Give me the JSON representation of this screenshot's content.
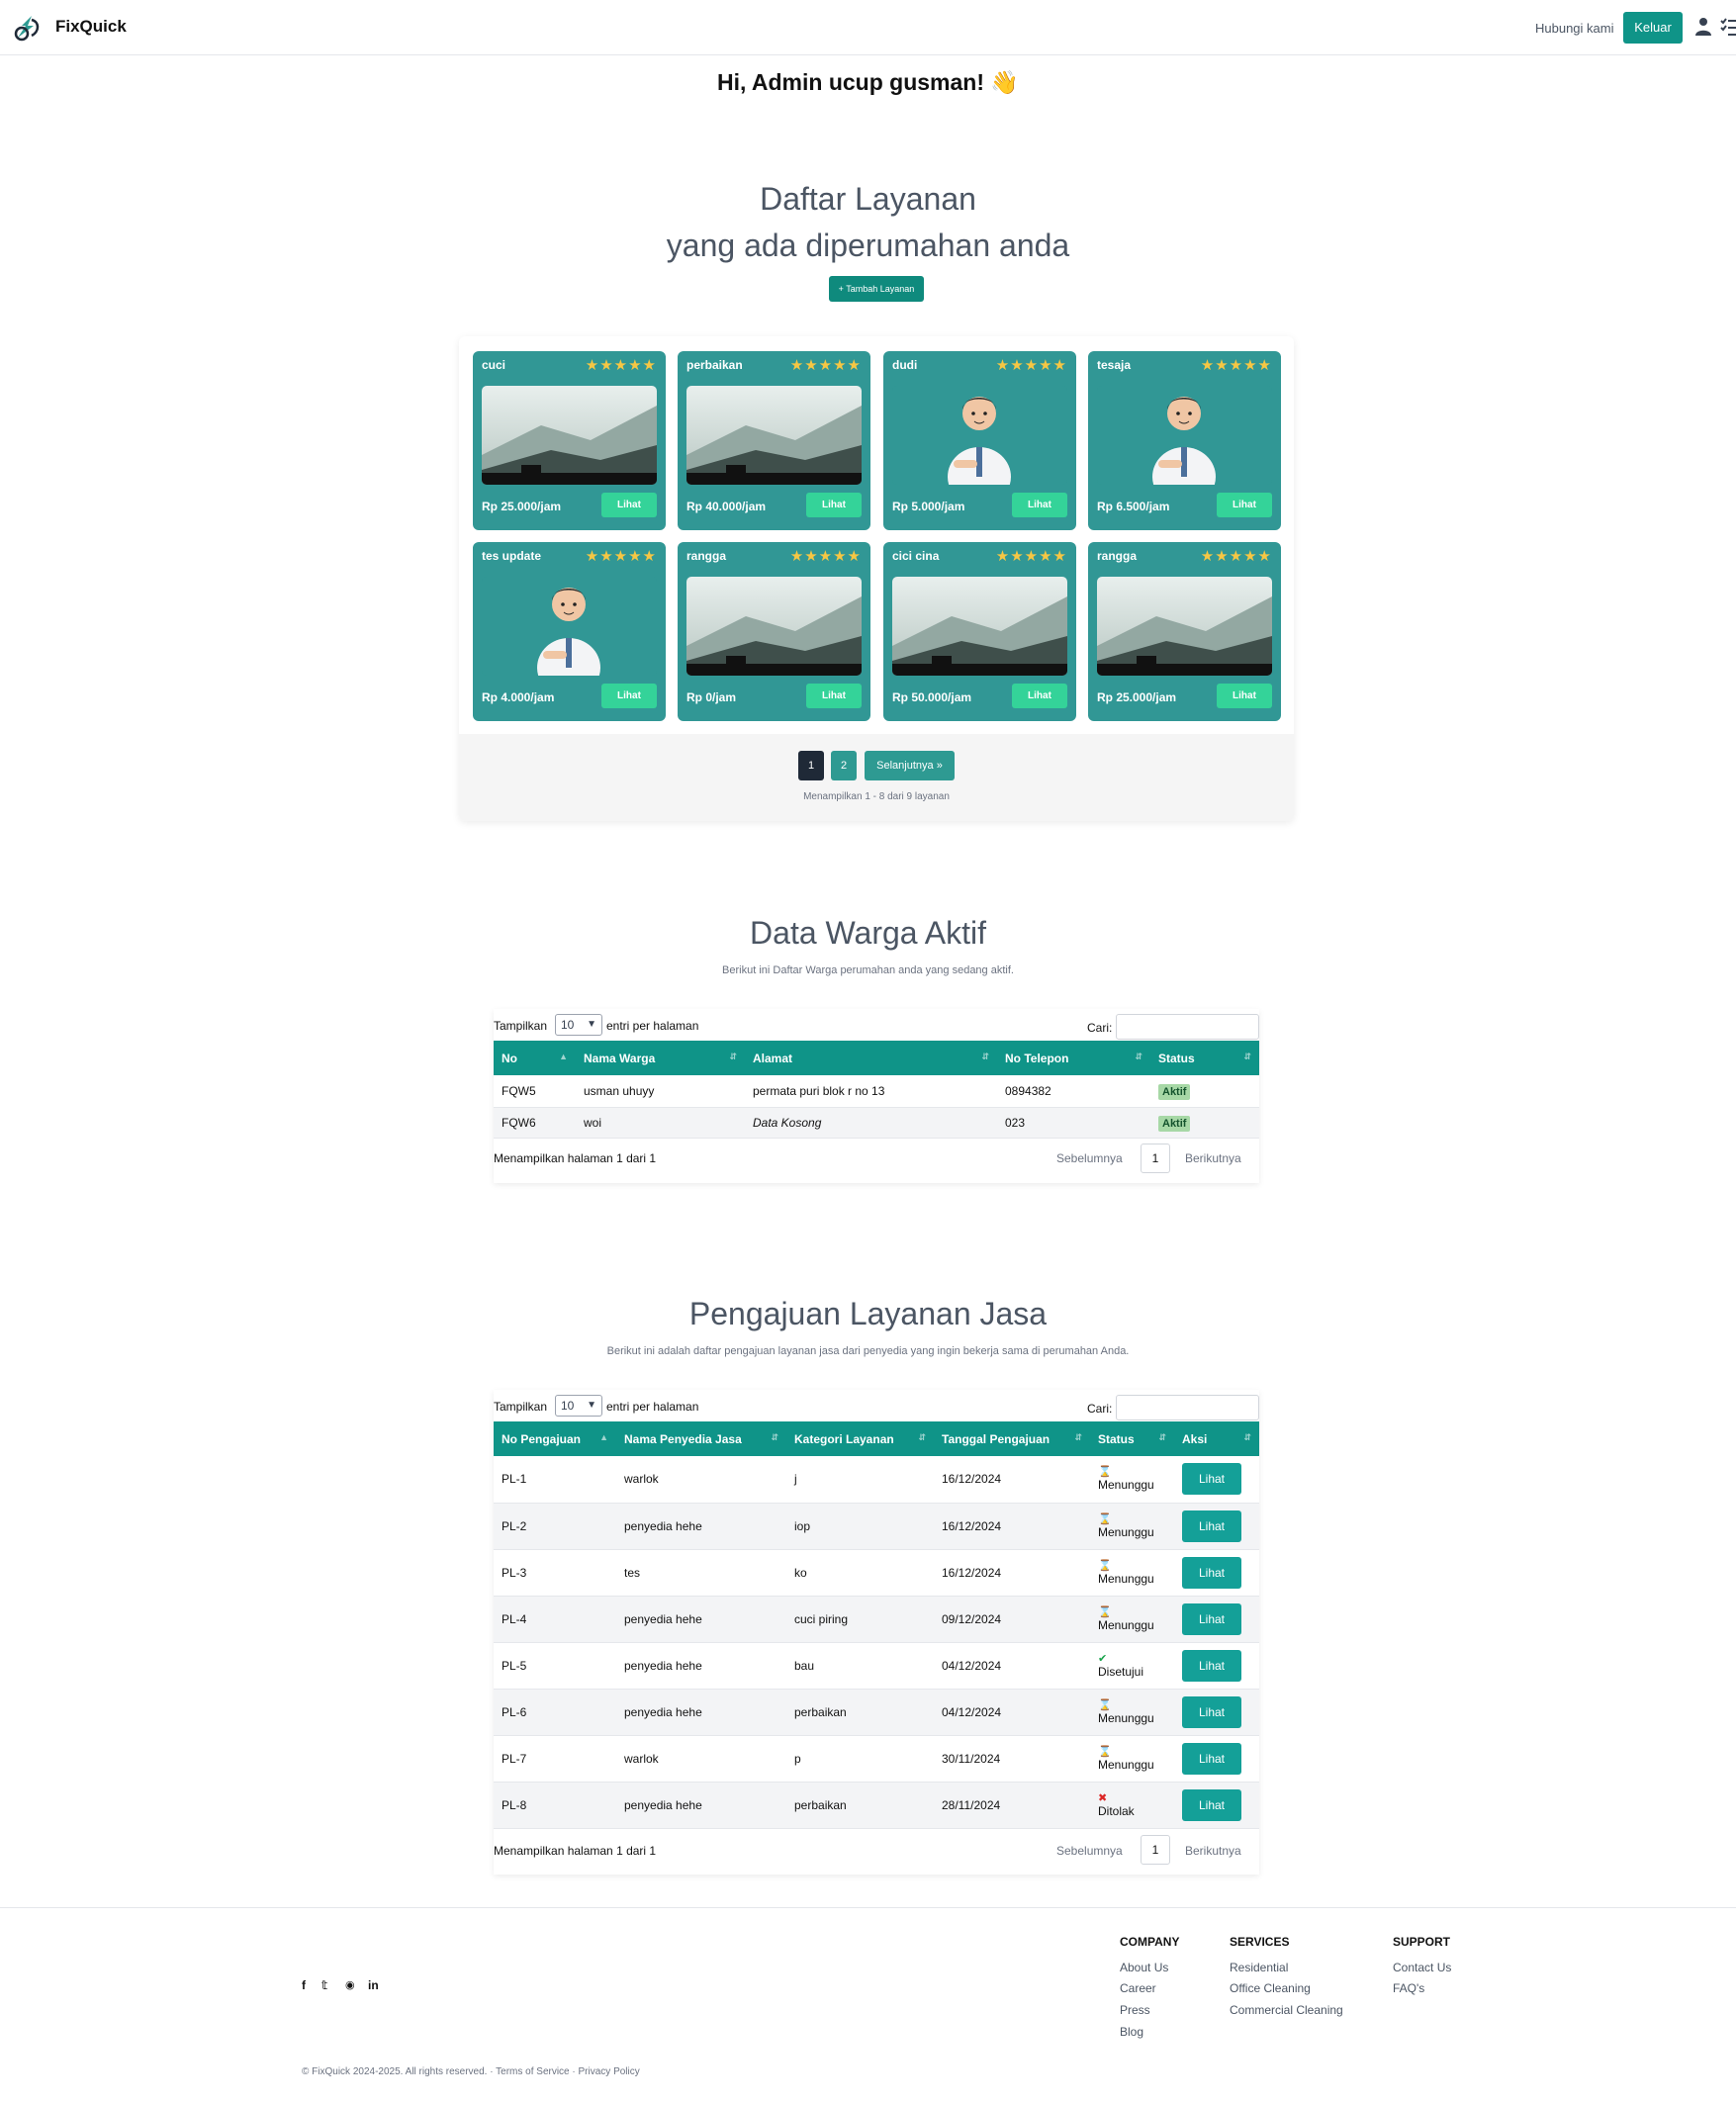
{
  "nav": {
    "brand": "FixQuick",
    "contact": "Hubungi kami",
    "logout": "Keluar"
  },
  "greeting": "Hi, Admin ucup gusman! 👋",
  "services": {
    "title_line1": "Daftar Layanan",
    "title_line2": "yang ada diperumahan anda",
    "add_button": "+ Tambah Layanan",
    "rating_stars": 5,
    "items": [
      {
        "name": "cuci",
        "price": "Rp 25.000/jam",
        "image": "landscape",
        "button": "Lihat"
      },
      {
        "name": "perbaikan",
        "price": "Rp 40.000/jam",
        "image": "landscape",
        "button": "Lihat"
      },
      {
        "name": "dudi",
        "price": "Rp 5.000/jam",
        "image": "avatar",
        "button": "Lihat"
      },
      {
        "name": "tesaja",
        "price": "Rp 6.500/jam",
        "image": "avatar",
        "button": "Lihat"
      },
      {
        "name": "tes update",
        "price": "Rp 4.000/jam",
        "image": "avatar",
        "button": "Lihat"
      },
      {
        "name": "rangga",
        "price": "Rp 0/jam",
        "image": "landscape",
        "button": "Lihat"
      },
      {
        "name": "cici cina",
        "price": "Rp 50.000/jam",
        "image": "landscape",
        "button": "Lihat"
      },
      {
        "name": "rangga",
        "price": "Rp 25.000/jam",
        "image": "landscape",
        "button": "Lihat"
      }
    ],
    "pagination": {
      "pages": [
        "1",
        "2"
      ],
      "current": "1",
      "next": "Selanjutnya »"
    },
    "info": "Menampilkan 1 - 8 dari 9 layanan"
  },
  "warga": {
    "title": "Data Warga Aktif",
    "subtitle": "Berikut ini Daftar Warga perumahan anda yang sedang aktif.",
    "show_label": "Tampilkan",
    "per_page": "10",
    "per_page_suffix": "entri per halaman",
    "search_label": "Cari:",
    "columns": [
      "No",
      "Nama Warga",
      "Alamat",
      "No Telepon",
      "Status"
    ],
    "rows": [
      {
        "no": "FQW5",
        "nama": "usman uhuyy",
        "alamat": "permata puri blok r no 13",
        "telepon": "0894382",
        "status": "Aktif"
      },
      {
        "no": "FQW6",
        "nama": "woi",
        "alamat": "Data Kosong",
        "telepon": "023",
        "status": "Aktif"
      }
    ],
    "footer_info": "Menampilkan halaman 1 dari 1",
    "prev": "Sebelumnya",
    "page": "1",
    "next": "Berikutnya"
  },
  "pengajuan": {
    "title": "Pengajuan Layanan Jasa",
    "subtitle": "Berikut ini adalah daftar pengajuan layanan jasa dari penyedia yang ingin bekerja sama di perumahan Anda.",
    "show_label": "Tampilkan",
    "per_page": "10",
    "per_page_suffix": "entri per halaman",
    "search_label": "Cari:",
    "columns": [
      "No Pengajuan",
      "Nama Penyedia Jasa",
      "Kategori Layanan",
      "Tanggal Pengajuan",
      "Status",
      "Aksi"
    ],
    "rows": [
      {
        "no": "PL-1",
        "nama": "warlok",
        "kategori": "j",
        "tanggal": "16/12/2024",
        "status": "Menunggu",
        "icon": "hourglass-icon",
        "aksi": "Lihat"
      },
      {
        "no": "PL-2",
        "nama": "penyedia hehe",
        "kategori": "iop",
        "tanggal": "16/12/2024",
        "status": "Menunggu",
        "icon": "hourglass-icon",
        "aksi": "Lihat"
      },
      {
        "no": "PL-3",
        "nama": "tes",
        "kategori": "ko",
        "tanggal": "16/12/2024",
        "status": "Menunggu",
        "icon": "hourglass-icon",
        "aksi": "Lihat"
      },
      {
        "no": "PL-4",
        "nama": "penyedia hehe",
        "kategori": "cuci piring",
        "tanggal": "09/12/2024",
        "status": "Menunggu",
        "icon": "hourglass-icon",
        "aksi": "Lihat"
      },
      {
        "no": "PL-5",
        "nama": "penyedia hehe",
        "kategori": "bau",
        "tanggal": "04/12/2024",
        "status": "Disetujui",
        "icon": "check-circle-icon",
        "aksi": "Lihat"
      },
      {
        "no": "PL-6",
        "nama": "penyedia hehe",
        "kategori": "perbaikan",
        "tanggal": "04/12/2024",
        "status": "Menunggu",
        "icon": "hourglass-icon",
        "aksi": "Lihat"
      },
      {
        "no": "PL-7",
        "nama": "warlok",
        "kategori": "p",
        "tanggal": "30/11/2024",
        "status": "Menunggu",
        "icon": "hourglass-icon",
        "aksi": "Lihat"
      },
      {
        "no": "PL-8",
        "nama": "penyedia hehe",
        "kategori": "perbaikan",
        "tanggal": "28/11/2024",
        "status": "Ditolak",
        "icon": "x-circle-icon",
        "aksi": "Lihat"
      }
    ],
    "footer_info": "Menampilkan halaman 1 dari 1",
    "prev": "Sebelumnya",
    "page": "1",
    "next": "Berikutnya"
  },
  "footer": {
    "social": [
      "facebook-icon",
      "twitter-icon",
      "instagram-icon",
      "linkedin-icon"
    ],
    "columns": [
      {
        "title": "COMPANY",
        "links": [
          "About Us",
          "Career",
          "Press",
          "Blog"
        ]
      },
      {
        "title": "SERVICES",
        "links": [
          "Residential",
          "Office Cleaning",
          "Commercial Cleaning"
        ]
      },
      {
        "title": "SUPPORT",
        "links": [
          "Contact Us",
          "FAQ's"
        ]
      }
    ],
    "copyright": "© FixQuick 2024-2025. All rights reserved. · Terms of Service · Privacy Policy"
  },
  "colors": {
    "primary": "#0f9488",
    "card": "#319795",
    "star": "#f6c744",
    "lihat": "#34d399"
  }
}
